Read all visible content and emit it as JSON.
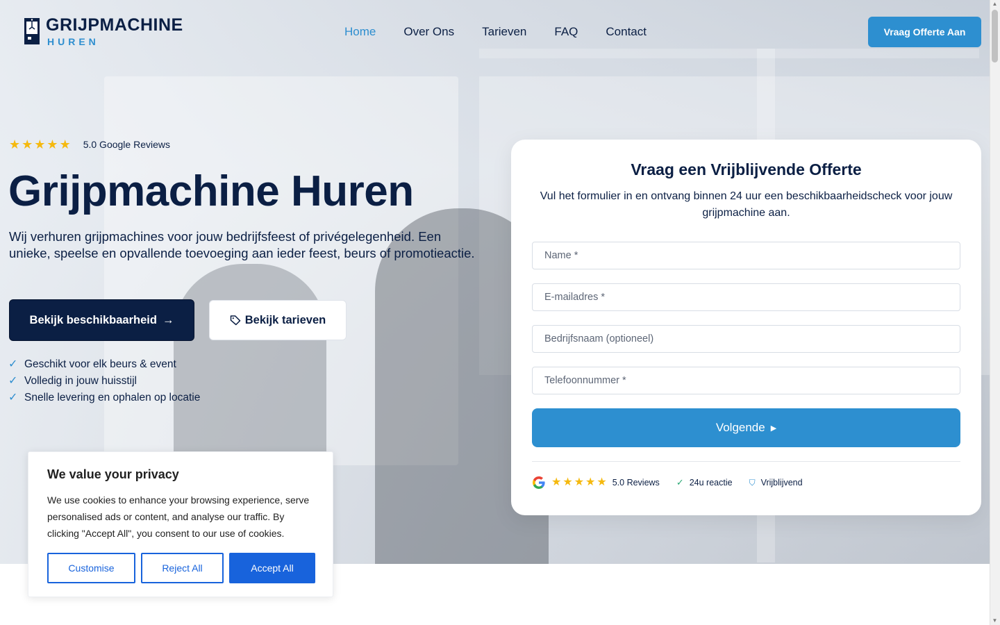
{
  "logo": {
    "line1": "GRIJPMACHINE",
    "line2": "HUREN",
    "icon": "claw-machine-icon"
  },
  "nav": {
    "items": [
      {
        "label": "Home",
        "active": true
      },
      {
        "label": "Over Ons",
        "active": false
      },
      {
        "label": "Tarieven",
        "active": false
      },
      {
        "label": "FAQ",
        "active": false
      },
      {
        "label": "Contact",
        "active": false
      }
    ],
    "cta": "Vraag Offerte Aan"
  },
  "hero": {
    "rating": 5,
    "reviews_text": "5.0 Google Reviews",
    "title": "Grijpmachine Huren",
    "description": "Wij verhuren grijpmachines voor jouw bedrijfsfeest of privégelegenheid. Een unieke, speelse en opvallende toevoeging aan ieder feest, beurs of promotieactie.",
    "primary_button": "Bekijk beschikbaarheid",
    "secondary_button": "Bekijk tarieven",
    "features": [
      "Geschikt voor elk beurs & event",
      "Volledig in jouw huisstijl",
      "Snelle levering en ophalen op locatie"
    ]
  },
  "form": {
    "title": "Vraag een Vrijblijvende Offerte",
    "subtitle": "Vul het formulier in en ontvang binnen 24 uur een beschikbaarheidscheck voor jouw grijpmachine aan.",
    "fields": {
      "name": {
        "placeholder": "Name *",
        "value": ""
      },
      "email": {
        "placeholder": "E-mailadres *",
        "value": ""
      },
      "company": {
        "placeholder": "Bedrijfsnaam (optioneel)",
        "value": ""
      },
      "phone": {
        "placeholder": "Telefoonnummer *",
        "value": ""
      }
    },
    "submit": "Volgende",
    "footer": {
      "reviews": "5.0 Reviews",
      "reaction": "24u reactie",
      "free": "Vrijblijvend"
    }
  },
  "cookie": {
    "title": "We value your privacy",
    "body": "We use cookies to enhance your browsing experience, serve personalised ads or content, and analyse our traffic. By clicking \"Accept All\", you consent to our use of cookies.",
    "customise": "Customise",
    "reject": "Reject All",
    "accept": "Accept All"
  },
  "colors": {
    "navy": "#0b1f44",
    "accent": "#2d8fd0",
    "star": "#f5b90f",
    "cookie_blue": "#1863dc"
  }
}
